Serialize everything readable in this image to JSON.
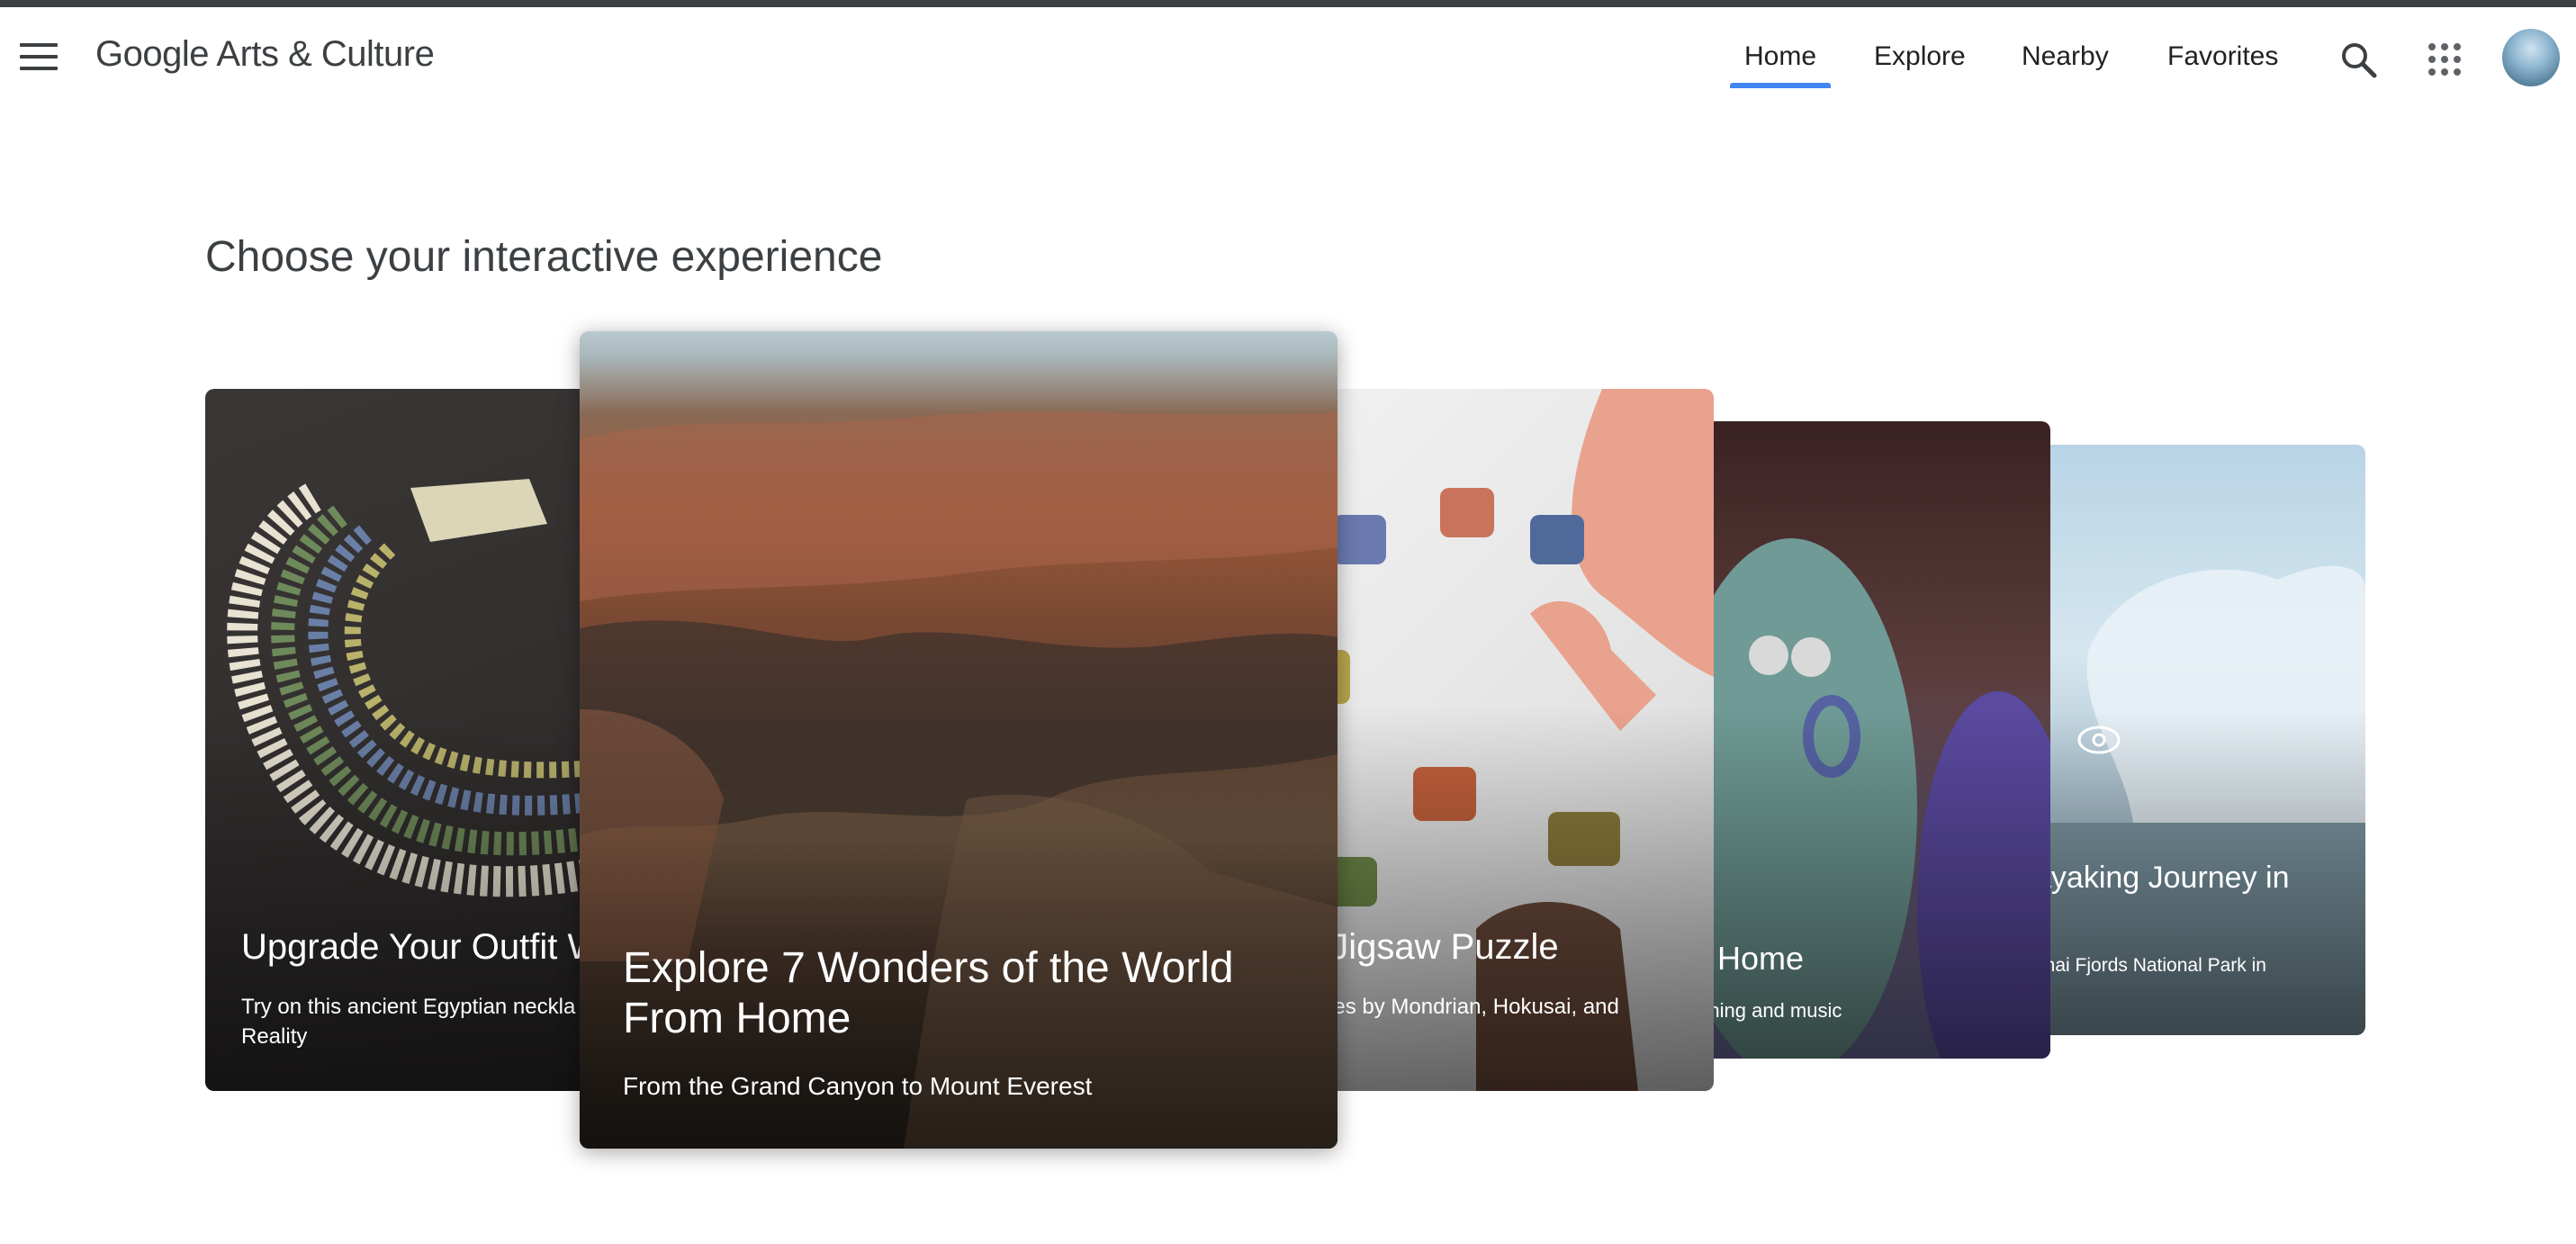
{
  "header": {
    "logo": "Google Arts & Culture",
    "nav": [
      "Home",
      "Explore",
      "Nearby",
      "Favorites"
    ],
    "active_nav": "Home"
  },
  "main": {
    "heading": "Choose your interactive experience",
    "cards": [
      {
        "title": "Upgrade Your Outfit W",
        "subtitle": "Try on this ancient Egyptian neckla Reality",
        "icon": "necklace-image"
      },
      {
        "title": "Explore 7 Wonders of the World From Home",
        "subtitle": "From the Grand Canyon to Mount Everest",
        "icon": "grand-canyon-image"
      },
      {
        "title": "t Jigsaw Puzzle",
        "subtitle": "eces by Mondrian, Hokusai, and",
        "icon": "jigsaw-image"
      },
      {
        "title": "rt at Home",
        "subtitle": "e Learning and music",
        "icon": "frogs-image"
      },
      {
        "title": "ayaking Journey in",
        "subtitle": "enai Fjords National Park in",
        "icon": "kayak-image"
      }
    ]
  },
  "colors": {
    "accent": "#4285f4",
    "topbar": "#3c4043"
  }
}
